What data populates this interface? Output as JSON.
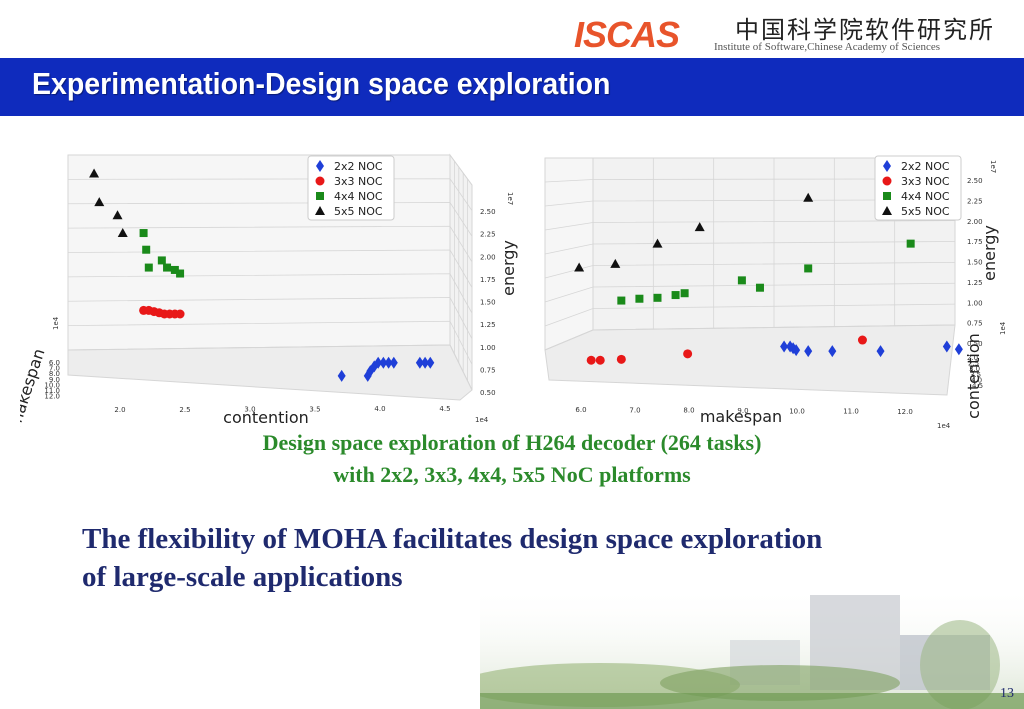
{
  "header": {
    "logo": "ISCAS",
    "cn_name": "中国科学院软件研究所",
    "institute": "Institute of Software,Chinese Academy of Sciences"
  },
  "title": "Experimentation-Design space exploration",
  "colors": {
    "title_bar": "#0f2bbd",
    "caption": "#2b8a2b",
    "body": "#1f2a6e",
    "noc_2x2": "#1f3fd8",
    "noc_3x3": "#e81818",
    "noc_4x4": "#1a8a1a",
    "noc_5x5": "#111111"
  },
  "legend": [
    "2x2 NOC",
    "3x3 NOC",
    "4x4 NOC",
    "5x5 NOC"
  ],
  "chart_data": [
    {
      "type": "scatter",
      "title": "",
      "xlabel": "contention",
      "ylabel": "makespan",
      "zlabel": "energy",
      "x_exp": "1e4",
      "y_exp": "1e4",
      "z_exp": "1e7",
      "x_ticks": [
        "2.0",
        "2.5",
        "3.0",
        "3.5",
        "4.0",
        "4.5"
      ],
      "y_ticks": [
        "6.0",
        "7.0",
        "8.0",
        "9.0",
        "10.0",
        "11.0",
        "12.0"
      ],
      "z_ticks": [
        "0.50",
        "0.75",
        "1.00",
        "1.25",
        "1.50",
        "1.75",
        "2.00",
        "2.25",
        "2.50"
      ],
      "xlim": [
        1.6,
        4.7
      ],
      "zlim": [
        0.5,
        2.6
      ],
      "legend_position": "top-center",
      "series": [
        {
          "name": "2x2 NOC",
          "marker": "diamond",
          "x": [
            3.7,
            3.9,
            3.92,
            3.95,
            3.98,
            4.02,
            4.06,
            4.1,
            4.3,
            4.34,
            4.38
          ],
          "z": [
            0.82,
            0.82,
            0.86,
            0.9,
            0.93,
            0.93,
            0.93,
            0.93,
            0.93,
            0.93,
            0.93
          ]
        },
        {
          "name": "3x3 NOC",
          "marker": "circle",
          "x": [
            2.18,
            2.22,
            2.26,
            2.3,
            2.34,
            2.38,
            2.42,
            2.46
          ],
          "z": [
            1.37,
            1.37,
            1.36,
            1.35,
            1.34,
            1.34,
            1.34,
            1.34
          ]
        },
        {
          "name": "4x4 NOC",
          "marker": "square",
          "x": [
            2.18,
            2.2,
            2.22,
            2.32,
            2.36,
            2.42,
            2.46
          ],
          "z": [
            2.02,
            1.88,
            1.73,
            1.79,
            1.73,
            1.71,
            1.68
          ]
        },
        {
          "name": "5x5 NOC",
          "marker": "triangle",
          "x": [
            1.8,
            1.84,
            1.98,
            2.02
          ],
          "z": [
            2.52,
            2.28,
            2.17,
            2.02
          ]
        }
      ]
    },
    {
      "type": "scatter",
      "title": "",
      "xlabel": "makespan",
      "ylabel": "contention",
      "zlabel": "energy",
      "x_exp": "1e4",
      "y_exp": "1e4",
      "z_exp": "1e7",
      "x_ticks": [
        "6.0",
        "7.0",
        "8.0",
        "9.0",
        "10.0",
        "11.0",
        "12.0"
      ],
      "y_ticks": [
        "2.0",
        "2.5",
        "3.0",
        "3.5",
        "4.0",
        "4.5"
      ],
      "z_ticks": [
        "0.50",
        "0.75",
        "1.00",
        "1.25",
        "1.50",
        "1.75",
        "2.00",
        "2.25",
        "2.50"
      ],
      "xlim": [
        5.6,
        12.8
      ],
      "zlim": [
        0.4,
        2.6
      ],
      "legend_position": "top-right",
      "series": [
        {
          "name": "2x2 NOC",
          "marker": "diamond",
          "x": [
            9.5,
            9.6,
            9.65,
            9.7,
            9.9,
            10.3,
            11.1,
            12.2,
            12.4
          ],
          "z": [
            0.58,
            0.58,
            0.56,
            0.54,
            0.53,
            0.53,
            0.53,
            0.58,
            0.55
          ]
        },
        {
          "name": "3x3 NOC",
          "marker": "circle",
          "x": [
            6.3,
            6.45,
            6.8,
            7.9,
            10.8
          ],
          "z": [
            0.43,
            0.43,
            0.44,
            0.5,
            0.65
          ]
        },
        {
          "name": "4x4 NOC",
          "marker": "square",
          "x": [
            6.8,
            7.1,
            7.4,
            7.7,
            7.85,
            8.8,
            9.1,
            9.9,
            11.6
          ],
          "z": [
            1.08,
            1.1,
            1.11,
            1.14,
            1.16,
            1.3,
            1.22,
            1.43,
            1.7
          ]
        },
        {
          "name": "5x5 NOC",
          "marker": "triangle",
          "x": [
            6.1,
            6.7,
            7.4,
            8.1,
            9.9
          ],
          "z": [
            1.44,
            1.48,
            1.7,
            1.88,
            2.2
          ]
        }
      ]
    }
  ],
  "caption_line1": "Design space exploration of H264 decoder (264 tasks)",
  "caption_line2": "with 2x2, 3x3, 4x4, 5x5 NoC platforms",
  "body_line1": "The flexibility of MOHA facilitates design space exploration",
  "body_line2": "of large-scale applications",
  "page_number": "13"
}
